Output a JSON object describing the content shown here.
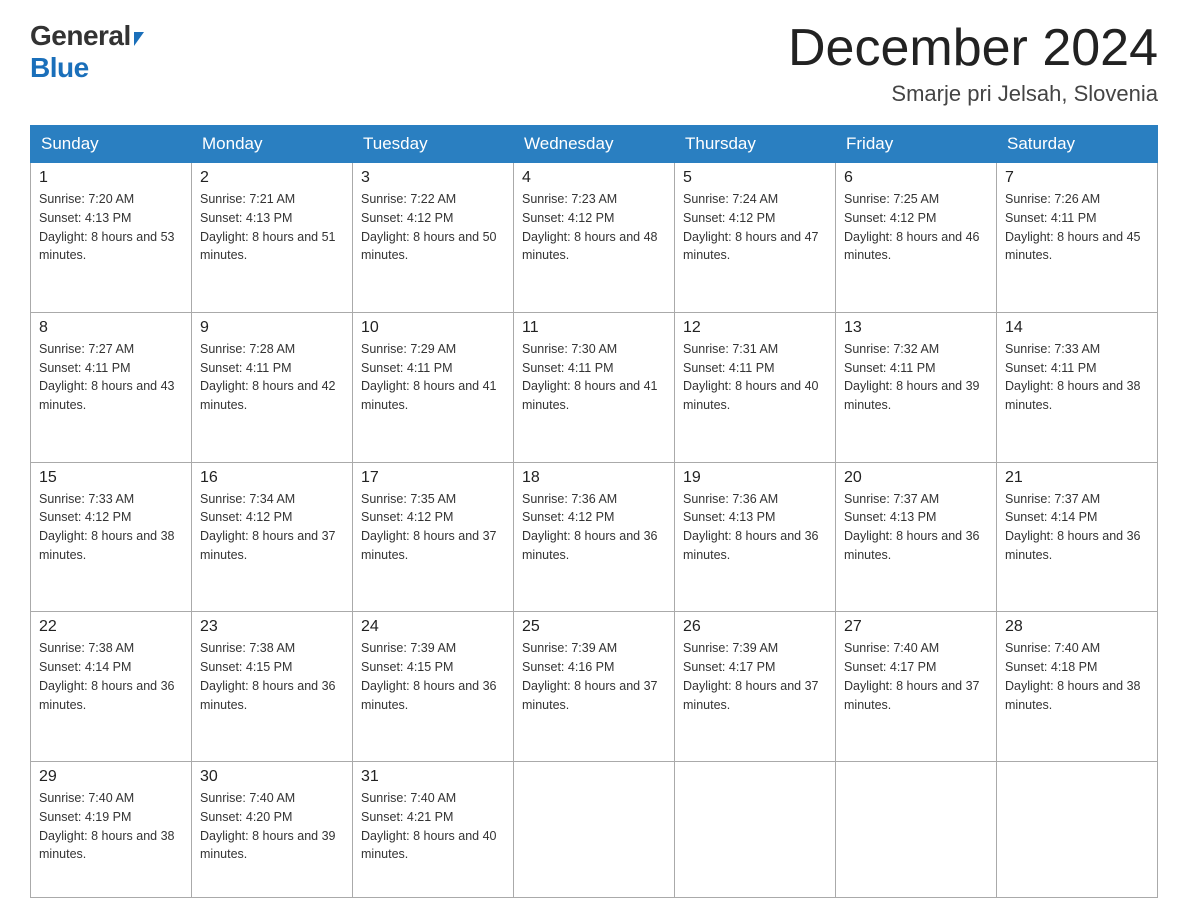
{
  "header": {
    "logo_general": "General",
    "logo_blue": "Blue",
    "month_title": "December 2024",
    "subtitle": "Smarje pri Jelsah, Slovenia"
  },
  "weekdays": [
    "Sunday",
    "Monday",
    "Tuesday",
    "Wednesday",
    "Thursday",
    "Friday",
    "Saturday"
  ],
  "weeks": [
    [
      {
        "day": "1",
        "sunrise": "7:20 AM",
        "sunset": "4:13 PM",
        "daylight": "8 hours and 53 minutes."
      },
      {
        "day": "2",
        "sunrise": "7:21 AM",
        "sunset": "4:13 PM",
        "daylight": "8 hours and 51 minutes."
      },
      {
        "day": "3",
        "sunrise": "7:22 AM",
        "sunset": "4:12 PM",
        "daylight": "8 hours and 50 minutes."
      },
      {
        "day": "4",
        "sunrise": "7:23 AM",
        "sunset": "4:12 PM",
        "daylight": "8 hours and 48 minutes."
      },
      {
        "day": "5",
        "sunrise": "7:24 AM",
        "sunset": "4:12 PM",
        "daylight": "8 hours and 47 minutes."
      },
      {
        "day": "6",
        "sunrise": "7:25 AM",
        "sunset": "4:12 PM",
        "daylight": "8 hours and 46 minutes."
      },
      {
        "day": "7",
        "sunrise": "7:26 AM",
        "sunset": "4:11 PM",
        "daylight": "8 hours and 45 minutes."
      }
    ],
    [
      {
        "day": "8",
        "sunrise": "7:27 AM",
        "sunset": "4:11 PM",
        "daylight": "8 hours and 43 minutes."
      },
      {
        "day": "9",
        "sunrise": "7:28 AM",
        "sunset": "4:11 PM",
        "daylight": "8 hours and 42 minutes."
      },
      {
        "day": "10",
        "sunrise": "7:29 AM",
        "sunset": "4:11 PM",
        "daylight": "8 hours and 41 minutes."
      },
      {
        "day": "11",
        "sunrise": "7:30 AM",
        "sunset": "4:11 PM",
        "daylight": "8 hours and 41 minutes."
      },
      {
        "day": "12",
        "sunrise": "7:31 AM",
        "sunset": "4:11 PM",
        "daylight": "8 hours and 40 minutes."
      },
      {
        "day": "13",
        "sunrise": "7:32 AM",
        "sunset": "4:11 PM",
        "daylight": "8 hours and 39 minutes."
      },
      {
        "day": "14",
        "sunrise": "7:33 AM",
        "sunset": "4:11 PM",
        "daylight": "8 hours and 38 minutes."
      }
    ],
    [
      {
        "day": "15",
        "sunrise": "7:33 AM",
        "sunset": "4:12 PM",
        "daylight": "8 hours and 38 minutes."
      },
      {
        "day": "16",
        "sunrise": "7:34 AM",
        "sunset": "4:12 PM",
        "daylight": "8 hours and 37 minutes."
      },
      {
        "day": "17",
        "sunrise": "7:35 AM",
        "sunset": "4:12 PM",
        "daylight": "8 hours and 37 minutes."
      },
      {
        "day": "18",
        "sunrise": "7:36 AM",
        "sunset": "4:12 PM",
        "daylight": "8 hours and 36 minutes."
      },
      {
        "day": "19",
        "sunrise": "7:36 AM",
        "sunset": "4:13 PM",
        "daylight": "8 hours and 36 minutes."
      },
      {
        "day": "20",
        "sunrise": "7:37 AM",
        "sunset": "4:13 PM",
        "daylight": "8 hours and 36 minutes."
      },
      {
        "day": "21",
        "sunrise": "7:37 AM",
        "sunset": "4:14 PM",
        "daylight": "8 hours and 36 minutes."
      }
    ],
    [
      {
        "day": "22",
        "sunrise": "7:38 AM",
        "sunset": "4:14 PM",
        "daylight": "8 hours and 36 minutes."
      },
      {
        "day": "23",
        "sunrise": "7:38 AM",
        "sunset": "4:15 PM",
        "daylight": "8 hours and 36 minutes."
      },
      {
        "day": "24",
        "sunrise": "7:39 AM",
        "sunset": "4:15 PM",
        "daylight": "8 hours and 36 minutes."
      },
      {
        "day": "25",
        "sunrise": "7:39 AM",
        "sunset": "4:16 PM",
        "daylight": "8 hours and 37 minutes."
      },
      {
        "day": "26",
        "sunrise": "7:39 AM",
        "sunset": "4:17 PM",
        "daylight": "8 hours and 37 minutes."
      },
      {
        "day": "27",
        "sunrise": "7:40 AM",
        "sunset": "4:17 PM",
        "daylight": "8 hours and 37 minutes."
      },
      {
        "day": "28",
        "sunrise": "7:40 AM",
        "sunset": "4:18 PM",
        "daylight": "8 hours and 38 minutes."
      }
    ],
    [
      {
        "day": "29",
        "sunrise": "7:40 AM",
        "sunset": "4:19 PM",
        "daylight": "8 hours and 38 minutes."
      },
      {
        "day": "30",
        "sunrise": "7:40 AM",
        "sunset": "4:20 PM",
        "daylight": "8 hours and 39 minutes."
      },
      {
        "day": "31",
        "sunrise": "7:40 AM",
        "sunset": "4:21 PM",
        "daylight": "8 hours and 40 minutes."
      },
      null,
      null,
      null,
      null
    ]
  ],
  "labels": {
    "sunrise_prefix": "Sunrise: ",
    "sunset_prefix": "Sunset: ",
    "daylight_prefix": "Daylight: "
  }
}
